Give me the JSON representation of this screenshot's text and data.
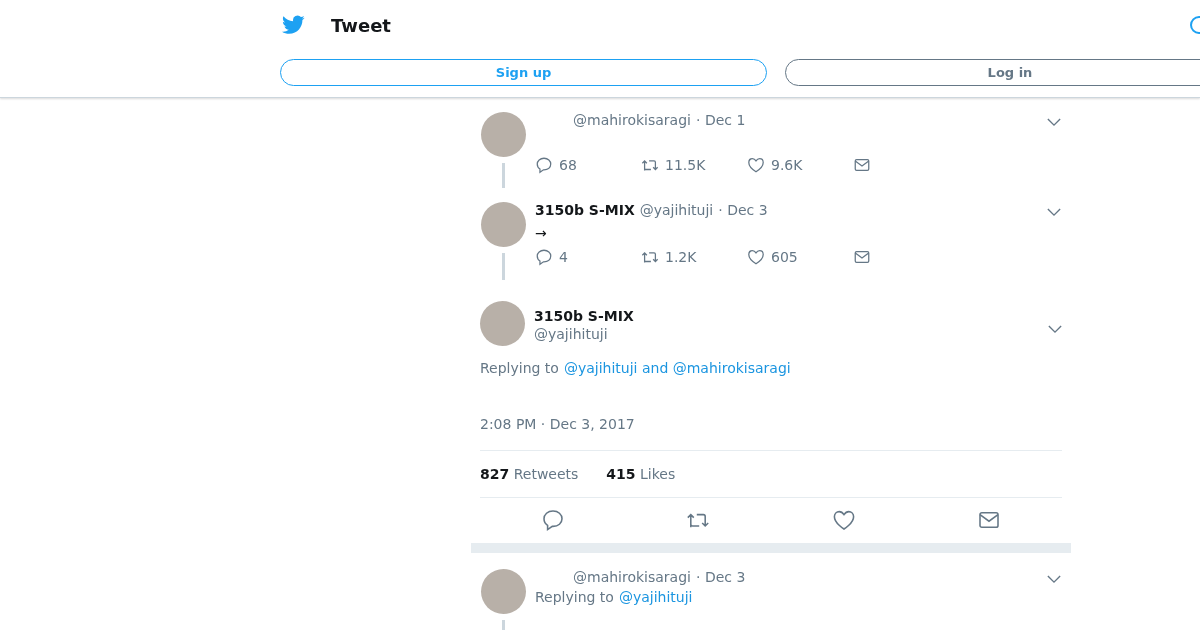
{
  "header": {
    "title": "Tweet",
    "buttons": [
      {
        "label": "Sign up",
        "kind": "primary"
      },
      {
        "label": "Log in",
        "kind": "secondary"
      }
    ]
  },
  "thread": [
    {
      "handle": "@mahirokisaragi",
      "date": "· Dec 1",
      "stats": {
        "replies": "68",
        "retweets": "11.5K",
        "likes": "9.6K"
      }
    },
    {
      "name": "3150b S-MIX",
      "handle": "@yajihituji",
      "date": "· Dec 3",
      "text": "→",
      "stats": {
        "replies": "4",
        "retweets": "1.2K",
        "likes": "605"
      }
    }
  ],
  "main_tweet": {
    "name": "3150b S-MIX",
    "handle": "@yajihituji",
    "replying_label": "Replying to",
    "replying_to": "@yajihituji and @mahirokisaragi",
    "timestamp": "2:08 PM · Dec 3, 2017",
    "retweets": {
      "count": "827",
      "label": "Retweets"
    },
    "likes": {
      "count": "415",
      "label": "Likes"
    }
  },
  "replies": [
    {
      "handle": "@mahirokisaragi",
      "date": "· Dec 3",
      "replying_label": "Replying to",
      "replying_to": "@yajihituji"
    }
  ]
}
